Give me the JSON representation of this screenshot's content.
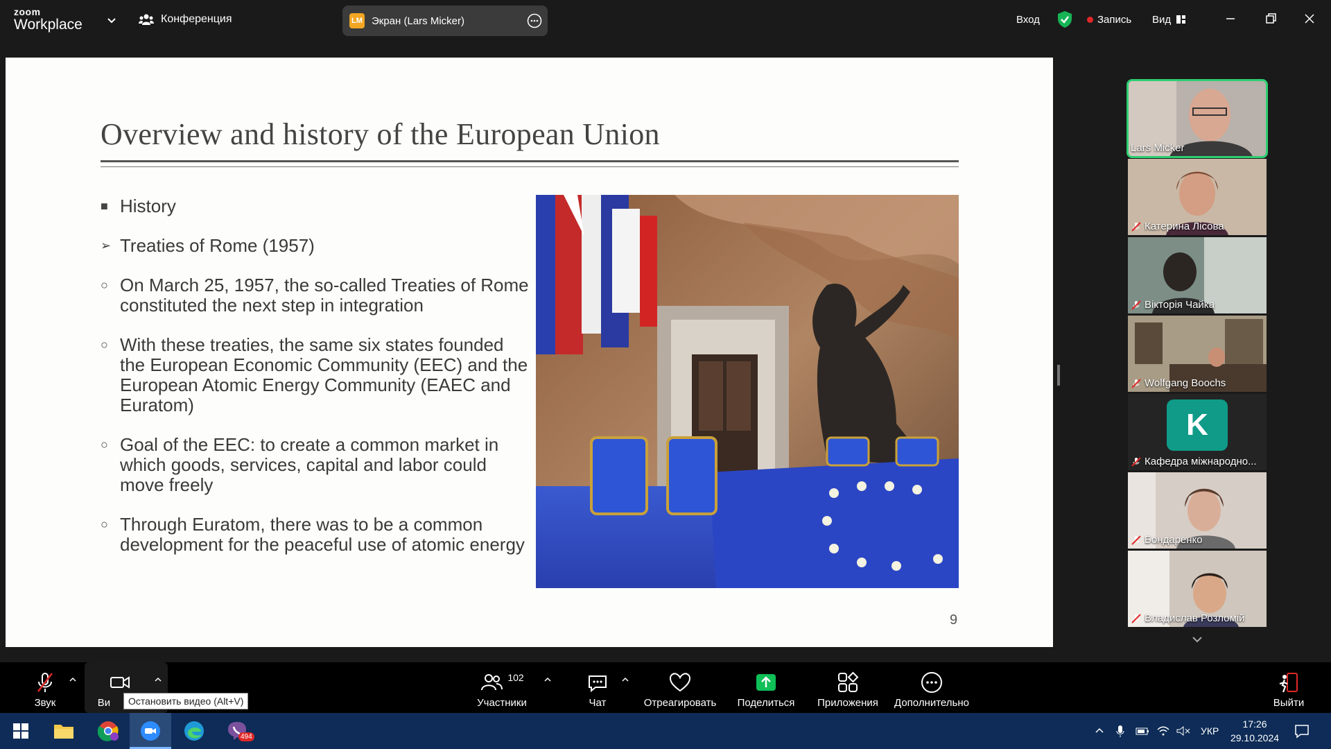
{
  "topbar": {
    "logo_line1": "zoom",
    "logo_line2": "Workplace",
    "meeting_label": "Конференция",
    "share_badge": "LM",
    "share_label": "Экран (Lars Micker)",
    "signin": "Вход",
    "record": "Запись",
    "view": "Вид"
  },
  "slide": {
    "title": "Overview and history of the European Union",
    "bullets": [
      {
        "marker": "■",
        "text": "History"
      },
      {
        "marker": "➢",
        "text": "Treaties of Rome (1957)"
      },
      {
        "marker": "○",
        "text": "On March 25, 1957, the so-called Treaties of Rome constituted the next step in integration"
      },
      {
        "marker": "○",
        "text": "With these treaties, the same six states founded the European Economic Community (EEC) and the European Atomic Energy Community (EAEC and Euratom)"
      },
      {
        "marker": "○",
        "text": "Goal of the EEC: to create a common market in which goods, services, capital and labor could move freely"
      },
      {
        "marker": "○",
        "text": "Through Euratom, there was to be a common development for the peaceful use of atomic energy"
      }
    ],
    "page_number": "9"
  },
  "participants": [
    {
      "name": "Lars Micker",
      "muted": false,
      "active": true
    },
    {
      "name": "Катерина Лісова",
      "muted": true
    },
    {
      "name": "Вікторія Чайка",
      "muted": true
    },
    {
      "name": "Wolfgang Boochs",
      "muted": true
    },
    {
      "name": "Кафедра міжнародно...",
      "muted": true,
      "avatar_letter": "K"
    },
    {
      "name": "Бондаренко",
      "muted": true
    },
    {
      "name": "Владислав Розломій",
      "muted": true
    }
  ],
  "toolbar": {
    "audio": "Звук",
    "video": "Ви",
    "video_tooltip": "Остановить видео (Alt+V)",
    "participants": "Участники",
    "participants_count": "102",
    "chat": "Чат",
    "react": "Отреагировать",
    "share": "Поделиться",
    "apps": "Приложения",
    "more": "Дополнительно",
    "leave": "Выйти"
  },
  "taskbar": {
    "apps": [
      "windows-start",
      "file-explorer",
      "chrome",
      "zoom",
      "edge",
      "viber"
    ],
    "viber_badge": "494",
    "lang": "УКР",
    "time": "17:26",
    "date": "29.10.2024"
  },
  "colors": {
    "accent_green": "#2ecf72",
    "record_red": "#e02828",
    "share_green": "#0fbf57",
    "taskbar": "#0e2c57"
  }
}
